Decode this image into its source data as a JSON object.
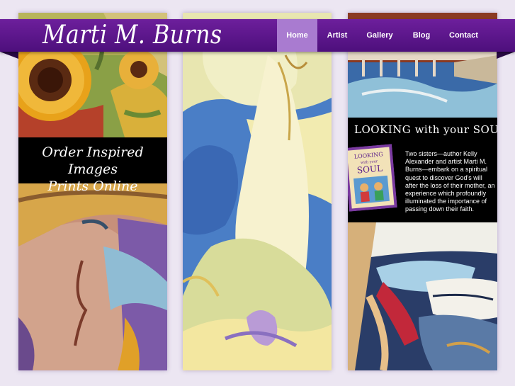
{
  "site": {
    "title": "Marti M. Burns"
  },
  "nav": [
    {
      "label": "Home",
      "active": true
    },
    {
      "label": "Artist",
      "active": false
    },
    {
      "label": "Gallery",
      "active": false
    },
    {
      "label": "Blog",
      "active": false
    },
    {
      "label": "Contact",
      "active": false
    }
  ],
  "order_banner": {
    "line1": "Order Inspired Images",
    "line2": "Prints Online"
  },
  "book": {
    "title": "LOOKING with your SOUL",
    "cover_title_small": "LOOKING",
    "cover_title_mid": "with your",
    "cover_title_big": "SOUL",
    "description": "Two sisters—author Kelly Alexander and artist Marti M. Burns—embark on a spiritual quest to discover God's will after the loss of their mother, an experience which profoundly illuminated the importance of passing down their faith."
  },
  "colors": {
    "header_purple": "#5e1790",
    "nav_active": "#a97bd0",
    "banner_black": "#000000"
  }
}
